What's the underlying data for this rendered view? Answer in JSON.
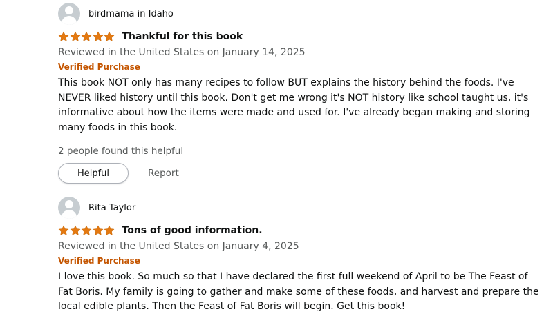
{
  "accent_colors": {
    "star": "#e47911",
    "verified": "#c45500",
    "secondary_text": "#565959",
    "primary_text": "#0f1111"
  },
  "reviews": [
    {
      "profile_name": "birdmama in Idaho",
      "rating": 5,
      "rating_max": 5,
      "title": "Thankful for this book",
      "date": "Reviewed in the United States on January 14, 2025",
      "verified": "Verified Purchase",
      "body": "This book NOT only has many recipes to follow BUT explains the history behind the foods. I've NEVER liked history until this book. Don't get me wrong it's NOT history like school taught us, it's informative about how the items were made and used for. I've already began making and storing many foods in this book.",
      "helpful_count": "2 people found this helpful",
      "helpful_label": "Helpful",
      "report_label": "Report"
    },
    {
      "profile_name": "Rita Taylor",
      "rating": 5,
      "rating_max": 5,
      "title": "Tons of good information.",
      "date": "Reviewed in the United States on January 4, 2025",
      "verified": "Verified Purchase",
      "body": "I love this book. So much so that I have declared the first full weekend of April to be The Feast of Fat Boris. My family is going to gather and make some of these foods, and harvest and prepare the local edible plants. Then the Feast of Fat Boris will begin. Get this book!"
    }
  ]
}
